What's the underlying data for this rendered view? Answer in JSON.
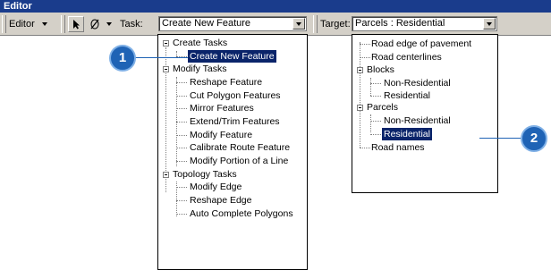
{
  "title": "Editor",
  "toolbar": {
    "editor_menu": "Editor",
    "task_label": "Task:",
    "task_value": "Create New Feature",
    "target_label": "Target:",
    "target_value": "Parcels : Residential"
  },
  "task_tree": {
    "groups": [
      {
        "label": "Create Tasks",
        "items": [
          "Create New Feature"
        ]
      },
      {
        "label": "Modify Tasks",
        "items": [
          "Reshape Feature",
          "Cut Polygon Features",
          "Mirror Features",
          "Extend/Trim Features",
          "Modify Feature",
          "Calibrate Route Feature",
          "Modify Portion of a Line"
        ]
      },
      {
        "label": "Topology Tasks",
        "items": [
          "Modify Edge",
          "Reshape Edge",
          "Auto Complete Polygons"
        ]
      }
    ],
    "selected": "Create New Feature"
  },
  "target_tree": {
    "top1": "Road  edge of pavement",
    "top2": "Road centerlines",
    "blocks": {
      "label": "Blocks",
      "items": [
        "Non-Residential",
        "Residential"
      ]
    },
    "parcels": {
      "label": "Parcels",
      "items": [
        "Non-Residential",
        "Residential"
      ]
    },
    "last": "Road names",
    "selected": "Residential"
  },
  "callouts": {
    "one": "1",
    "two": "2"
  },
  "colors": {
    "titlebar": "#1a3c8c",
    "selection": "#0a246a",
    "callout": "#1f63b5"
  }
}
